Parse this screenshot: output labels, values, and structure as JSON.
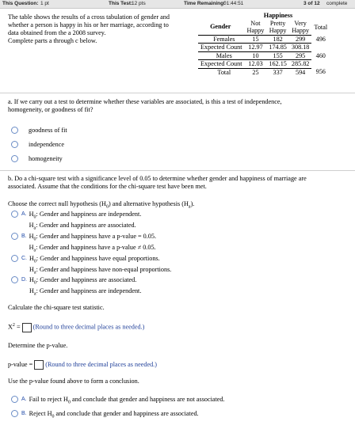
{
  "topbar": {
    "this_question_label": "This Question:",
    "this_question_value": "1 pt",
    "this_test_label": "This Test:",
    "this_test_value": "12 pts",
    "time_label": "Time Remaining:",
    "time_value": "01:44:51",
    "progress": "3 of 12",
    "status": "complete"
  },
  "intro": {
    "line1": "The table shows the results of a cross tabulation of gender and",
    "line2": "whether a person is happy in his or her marriage, according to",
    "line3": "data obtained from the a 2008 survey.",
    "line4": "Complete parts a through c below."
  },
  "table": {
    "group_header": "Happiness",
    "col_gender": "Gender",
    "col_not_1": "Not",
    "col_not_2": "Happy",
    "col_pretty_1": "Pretty",
    "col_pretty_2": "Happy",
    "col_very_1": "Very",
    "col_very_2": "Happy",
    "col_total": "Total",
    "rows": [
      {
        "label": "Females",
        "c1": "15",
        "c2": "182",
        "c3": "299",
        "total": "496"
      },
      {
        "label": "Expected Count",
        "c1": "12.97",
        "c2": "174.85",
        "c3": "308.18",
        "total": ""
      },
      {
        "label": "Males",
        "c1": "10",
        "c2": "155",
        "c3": "295",
        "total": "460"
      },
      {
        "label": "Expected Count",
        "c1": "12.03",
        "c2": "162.15",
        "c3": "285.82",
        "total": ""
      },
      {
        "label": "Total",
        "c1": "25",
        "c2": "337",
        "c3": "594",
        "total": "956"
      }
    ]
  },
  "part_a": {
    "question_1": "a. If we carry out a test to determine whether these variables are associated, is this a test of independence,",
    "question_2": "homogeneity, or goodness of fit?",
    "options": [
      "goodness of fit",
      "independence",
      "homogeneity"
    ]
  },
  "part_b": {
    "question_1": "b. Do a chi-square test with a significance level of 0.05 to determine whether gender and happiness of marriage are",
    "question_2": "associated. Assume that the conditions for the chi-square test have been met.",
    "choose_prefix": "Choose the correct null hypothesis (H",
    "choose_mid": ") and alternative hypothesis (H",
    "choose_suffix": ").",
    "sub0": "0",
    "suba": "a",
    "H": "H",
    "hypotheses": [
      {
        "letter": "A.",
        "h0": ": Gender and happiness are independent.",
        "ha": ": Gender and happiness are associated."
      },
      {
        "letter": "B.",
        "h0": ": Gender and happiness have a p-value = 0.05.",
        "ha": ": Gender and happiness have a p-value ≠ 0.05."
      },
      {
        "letter": "C.",
        "h0": ": Gender and happiness have equal proportions.",
        "ha": ": Gender and happiness have non-equal proportions."
      },
      {
        "letter": "D.",
        "h0": ": Gender and happiness are associated.",
        "ha": ": Gender and happiness are independent."
      }
    ],
    "calc_label": "Calculate the chi-square test statistic.",
    "chi_label": "X",
    "chi_sup": "2",
    "chi_eq": " =",
    "chi_note": "(Round to three decimal places as needed.)",
    "p_determine": "Determine the p-value.",
    "p_label": "p-value =",
    "p_note": "(Round to three decimal places as needed.)",
    "conclusion_label": "Use the p-value found above to form a conclusion.",
    "conclusions": [
      {
        "letter": "A.",
        "pre": "Fail to reject H",
        "sub": "0",
        "post": " and conclude that gender and happiness are not associated."
      },
      {
        "letter": "B.",
        "pre": "Reject H",
        "sub": "0",
        "post": " and conclude that gender and happiness are associated."
      }
    ]
  }
}
